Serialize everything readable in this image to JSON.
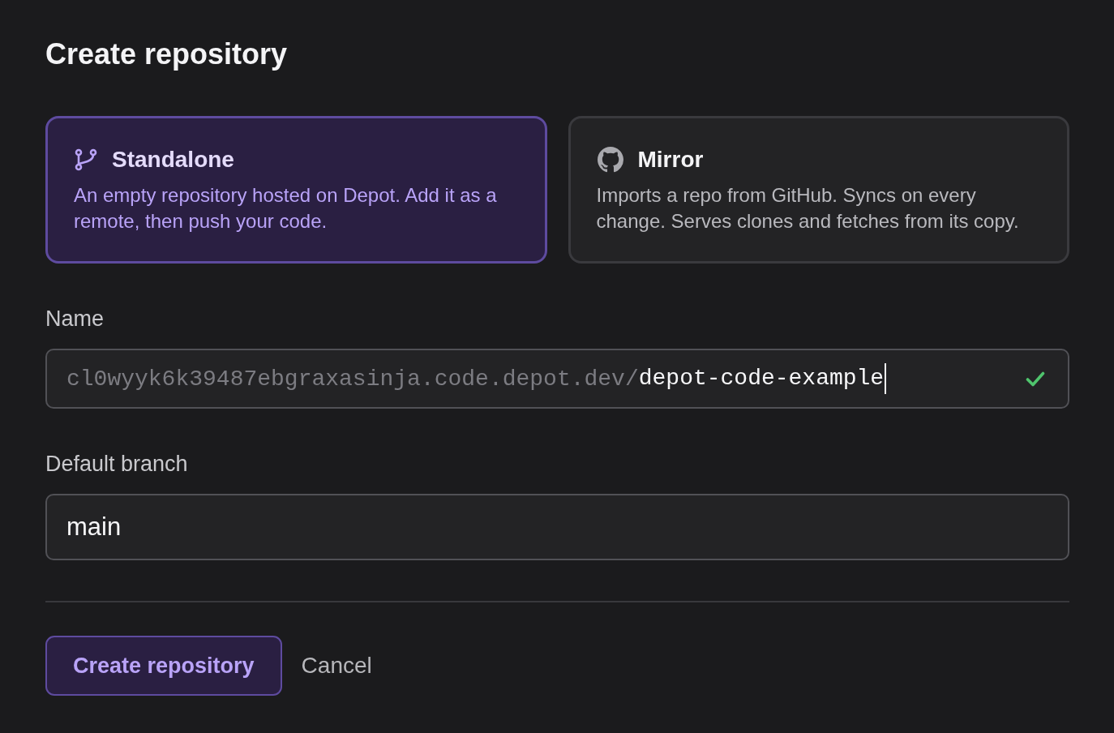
{
  "title": "Create repository",
  "repo_types": [
    {
      "kind": "standalone",
      "title": "Standalone",
      "description": "An empty repository hosted on Depot. Add it as a remote, then push your code.",
      "selected": true
    },
    {
      "kind": "mirror",
      "title": "Mirror",
      "description": "Imports a repo from GitHub. Syncs on every change. Serves clones and fetches from its copy.",
      "selected": false
    }
  ],
  "name_field": {
    "label": "Name",
    "prefix": "cl0wyyk6k39487ebgraxasinja.code.depot.dev/",
    "value": "depot-code-example",
    "focused": true,
    "valid": true
  },
  "branch_field": {
    "label": "Default branch",
    "value": "main"
  },
  "actions": [
    {
      "kind": "primary",
      "label": "Create repository"
    },
    {
      "kind": "plain",
      "label": "Cancel"
    }
  ]
}
